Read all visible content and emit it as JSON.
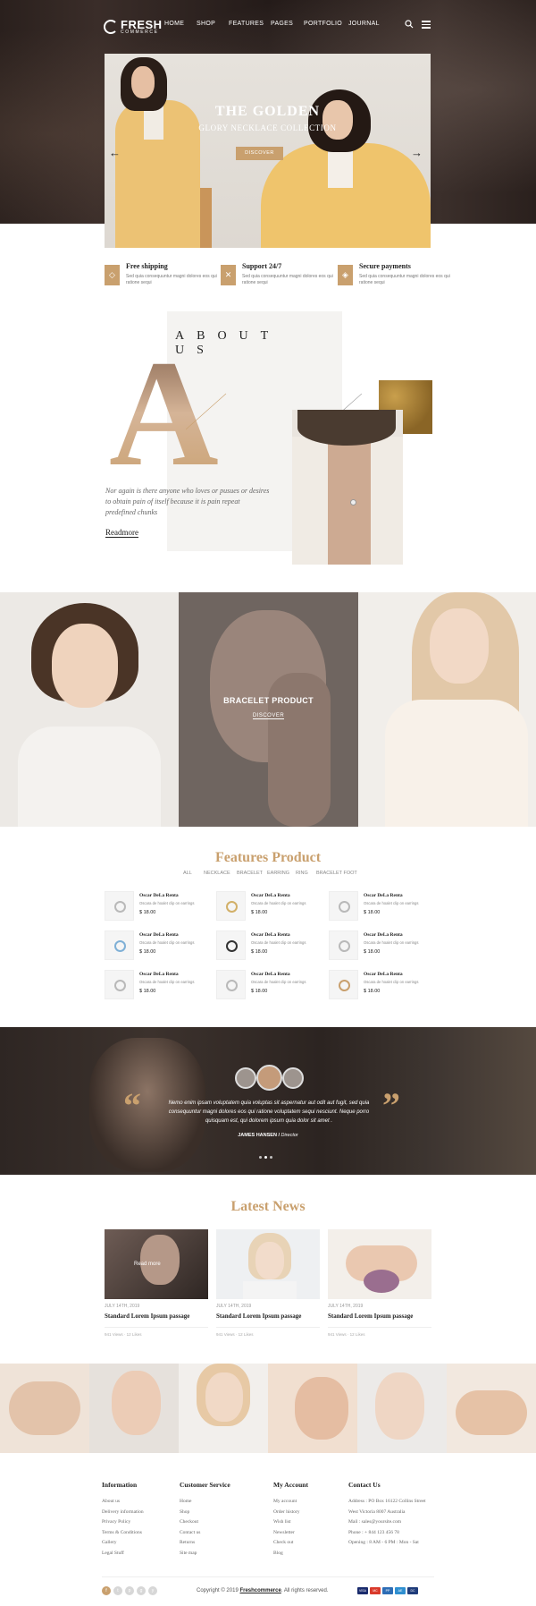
{
  "header": {
    "brand": "FRESH",
    "brand_sub": "COMMERCE",
    "nav": [
      "HOME",
      "SHOP",
      "FEATURES",
      "PAGES",
      "PORTFOLIO",
      "JOURNAL"
    ]
  },
  "hero": {
    "title": "THE GOLDEN",
    "subtitle": "GLORY NECKLACE COLLECTION",
    "button": "DISCOVER",
    "prev": "←",
    "next": "→"
  },
  "features": [
    {
      "title": "Free shipping",
      "text": "Sed quia consequuntur magni dolores eos qui ratione sequi",
      "icon": "diamond-icon"
    },
    {
      "title": "Support 24/7",
      "text": "Sed quia consequuntur magni dolores eos qui ratione sequi",
      "icon": "support-icon"
    },
    {
      "title": "Secure payments",
      "text": "Sed quia consequuntur magni dolores eos qui ratione sequi",
      "icon": "shield-icon"
    }
  ],
  "about": {
    "title": "ABOUT US",
    "letter": "A",
    "text": "Nor again is there anyone who loves or pusues or desires to obtain pain of itself because it is pain repeat predefined chunks",
    "link": "Readmore"
  },
  "banner": {
    "title": "BRACELET PRODUCT",
    "link": "DISCOVER"
  },
  "products_section": {
    "title": "Features Product",
    "filters": [
      "ALL",
      "NECKLACE",
      "BRACELET",
      "EARRING",
      "RING",
      "BRACELET FOOT"
    ],
    "items": [
      {
        "name": "Oscar DeLa Renta",
        "desc": "Oscara de hoalet clip on earrings",
        "price": "$ 18.00"
      },
      {
        "name": "Oscar DeLa Renta",
        "desc": "Oscara de hoalet clip on earrings",
        "price": "$ 18.00"
      },
      {
        "name": "Oscar DeLa Renta",
        "desc": "Oscara de hoalet clip on earrings",
        "price": "$ 18.00"
      },
      {
        "name": "Oscar DeLa Renta",
        "desc": "Oscara de hoalet clip on earrings",
        "price": "$ 18.00"
      },
      {
        "name": "Oscar DeLa Renta",
        "desc": "Oscara de hoalet clip on earrings",
        "price": "$ 18.00"
      },
      {
        "name": "Oscar DeLa Renta",
        "desc": "Oscara de hoalet clip on earrings",
        "price": "$ 18.00"
      },
      {
        "name": "Oscar DeLa Renta",
        "desc": "Oscara de hoalet clip on earrings",
        "price": "$ 18.00"
      },
      {
        "name": "Oscar DeLa Renta",
        "desc": "Oscara de hoalet clip on earrings",
        "price": "$ 18.00"
      },
      {
        "name": "Oscar DeLa Renta",
        "desc": "Oscara de hoalet clip on earrings",
        "price": "$ 18.00"
      }
    ]
  },
  "testimonial": {
    "text": "Nemo enim ipsam voluptatem quia voluptas sit aspernatur aut odit aut fugit, sed quia consequuntur magni dolores eos qui ratione voluptatem sequi nesciunt. Neque porro quisquam est, qui dolorem ipsum quia dolor sit amet .",
    "author": "JAMES HANSEN",
    "role": "Director",
    "quote_open": "“",
    "quote_close": "”"
  },
  "news": {
    "title": "Latest News",
    "readmore": "Read more",
    "items": [
      {
        "date": "JULY 14TH, 2019",
        "title": "Standard Lorem Ipsum passage",
        "meta": "941 Views  ·  12 Likes"
      },
      {
        "date": "JULY 14TH, 2019",
        "title": "Standard Lorem Ipsum passage",
        "meta": "941 Views  ·  12 Likes"
      },
      {
        "date": "JULY 14TH, 2019",
        "title": "Standard Lorem Ipsum passage",
        "meta": "941 Views  ·  12 Likes"
      }
    ]
  },
  "footer": {
    "columns": [
      {
        "title": "Information",
        "items": [
          "About us",
          "Delivery information",
          "Privacy Policy",
          "Terms & Conditions",
          "Gallery",
          "Legal Stuff"
        ]
      },
      {
        "title": "Customer Service",
        "items": [
          "Home",
          "Shop",
          "Checkout",
          "Contact us",
          "Returns",
          "Site map"
        ]
      },
      {
        "title": "My Account",
        "items": [
          "My account",
          "Order history",
          "Wish list",
          "Newsletter",
          "Check out",
          "Blog"
        ]
      },
      {
        "title": "Contact Us",
        "items": [
          "Address : PO Box 16122 Collins Street",
          "West Victoria 8007 Australia",
          "Mail : sales@yoursite.com",
          "Phone : + 844 123 456 78",
          "Opening : 8 AM - 6 PM : Mon - Sat"
        ]
      }
    ],
    "socials": [
      "f",
      "t",
      "p",
      "g",
      "y"
    ],
    "copyright_pre": "Copyright © 2019",
    "copyright_brand": "Freshcommerce",
    "copyright_post": ". All rights reserved.",
    "payments": [
      {
        "label": "VISA",
        "color": "#1a2b6d"
      },
      {
        "label": "MC",
        "color": "#d93a2b"
      },
      {
        "label": "PP",
        "color": "#2d6db5"
      },
      {
        "label": "AE",
        "color": "#2f8fd0"
      },
      {
        "label": "DC",
        "color": "#1f3c7a"
      }
    ]
  },
  "colors": {
    "accent": "#c9a06e",
    "dark": "#2a201d"
  }
}
